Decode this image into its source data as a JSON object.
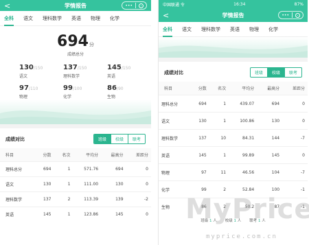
{
  "left": {
    "nav": {
      "back": "<",
      "title": "学情报告",
      "caps_more": "•••"
    },
    "tabs": [
      "全科",
      "语文",
      "理科数学",
      "英语",
      "物理",
      "化学"
    ],
    "total": {
      "score": "694",
      "unit": "分",
      "label": "成绩总分"
    },
    "subjects": [
      {
        "value": "130",
        "full": "/150",
        "name": "语文"
      },
      {
        "value": "137",
        "full": "/150",
        "name": "理科数学"
      },
      {
        "value": "145",
        "full": "/150",
        "name": "英语"
      },
      {
        "value": "97",
        "full": "/110",
        "name": "物理"
      },
      {
        "value": "99",
        "full": "/100",
        "name": "化学"
      },
      {
        "value": "86",
        "full": "/90",
        "name": "生物"
      }
    ],
    "compare": {
      "title": "成绩对比",
      "segments": [
        "班级",
        "校级",
        "联考"
      ],
      "active_segment": 0,
      "headers": [
        "科目",
        "分数",
        "名次",
        "平均分",
        "最高分",
        "差距分"
      ],
      "rows": [
        [
          "理科总分",
          "694",
          "1",
          "571.76",
          "694",
          "0"
        ],
        [
          "语文",
          "130",
          "1",
          "111.00",
          "130",
          "0"
        ],
        [
          "理科数学",
          "137",
          "2",
          "113.39",
          "139",
          "-2"
        ],
        [
          "英语",
          "145",
          "1",
          "123.86",
          "145",
          "0"
        ]
      ]
    }
  },
  "right": {
    "status": {
      "carrier": "中国联通 令",
      "time": "16:34",
      "battery": "87%"
    },
    "nav": {
      "back": "<",
      "title": "学情报告",
      "caps_more": "•••"
    },
    "tabs": [
      "全科",
      "语文",
      "理科数学",
      "英语",
      "物理",
      "化学"
    ],
    "compare": {
      "title": "成绩对比",
      "segments": [
        "班级",
        "校级",
        "联考"
      ],
      "active_segment": 1,
      "headers": [
        "科目",
        "分数",
        "名次",
        "平均分",
        "最高分",
        "差距分"
      ],
      "rows": [
        [
          "理科总分",
          "694",
          "1",
          "439.07",
          "694",
          "0"
        ],
        [
          "语文",
          "130",
          "1",
          "100.86",
          "130",
          "0"
        ],
        [
          "理科数学",
          "137",
          "10",
          "84.31",
          "144",
          "-7"
        ],
        [
          "英语",
          "145",
          "1",
          "99.89",
          "145",
          "0"
        ],
        [
          "物理",
          "97",
          "11",
          "46.56",
          "104",
          "-7"
        ],
        [
          "化学",
          "99",
          "2",
          "52.84",
          "100",
          "-1"
        ],
        [
          "生物",
          "86",
          "2",
          "50.2",
          "87",
          "-1"
        ]
      ]
    },
    "legend": [
      {
        "label": "班级",
        "value": "1",
        "unit": "人"
      },
      {
        "label": "校级",
        "value": "1",
        "unit": "人"
      },
      {
        "label": "联考",
        "value": "1",
        "unit": "人"
      }
    ]
  },
  "watermark": {
    "main": "MyPrice",
    "sub": "myprice.com.cn"
  },
  "colors": {
    "brand": "#35c39e",
    "accent": "#2bb58f"
  }
}
